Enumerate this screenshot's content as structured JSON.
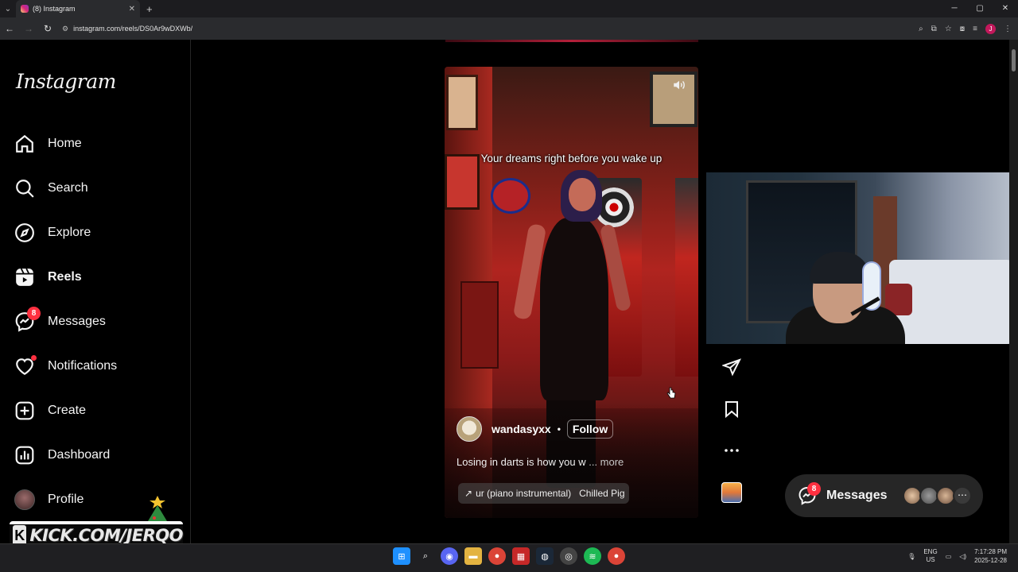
{
  "browser": {
    "tab_title": "(8) Instagram",
    "tab_close": "✕",
    "new_tab": "+",
    "url": "instagram.com/reels/DS0Ar9wDXWb/",
    "window_controls": [
      "─",
      "▢",
      "✕"
    ]
  },
  "sidebar": {
    "logo": "Instagram",
    "items": [
      {
        "label": "Home",
        "icon": "home-icon"
      },
      {
        "label": "Search",
        "icon": "search-icon"
      },
      {
        "label": "Explore",
        "icon": "compass-icon"
      },
      {
        "label": "Reels",
        "icon": "reels-icon",
        "active": true
      },
      {
        "label": "Messages",
        "icon": "messenger-icon",
        "badge": "8"
      },
      {
        "label": "Notifications",
        "icon": "heart-icon",
        "dot": true
      },
      {
        "label": "Create",
        "icon": "plus-square-icon"
      },
      {
        "label": "Dashboard",
        "icon": "dashboard-icon"
      },
      {
        "label": "Profile",
        "icon": "avatar"
      }
    ]
  },
  "overlay": {
    "kick_logo": "K",
    "kick_text": "KICK.COM/JERQO"
  },
  "reel": {
    "caption_overlay": "Your dreams right before you wake up",
    "username": "wandasyxx",
    "separator": "•",
    "follow_label": "Follow",
    "caption": "Losing in darts is how you w",
    "more_label": "... more",
    "audio_arrow": "↗",
    "audio_track": "ur (piano instrumental)",
    "audio_artist": "Chilled Pig"
  },
  "actions": {
    "share": "send-icon",
    "save": "bookmark-icon",
    "more": "more-horizontal-icon"
  },
  "messages_bar": {
    "label": "Messages",
    "badge": "8",
    "more": "⋯"
  },
  "taskbar": {
    "lang_top": "ENG",
    "lang_bottom": "US",
    "time": "7:17:28 PM",
    "date": "2025-12-28"
  },
  "colors": {
    "badge": "#ff3040",
    "background": "#000000",
    "accent_instagram": "#d62976"
  }
}
